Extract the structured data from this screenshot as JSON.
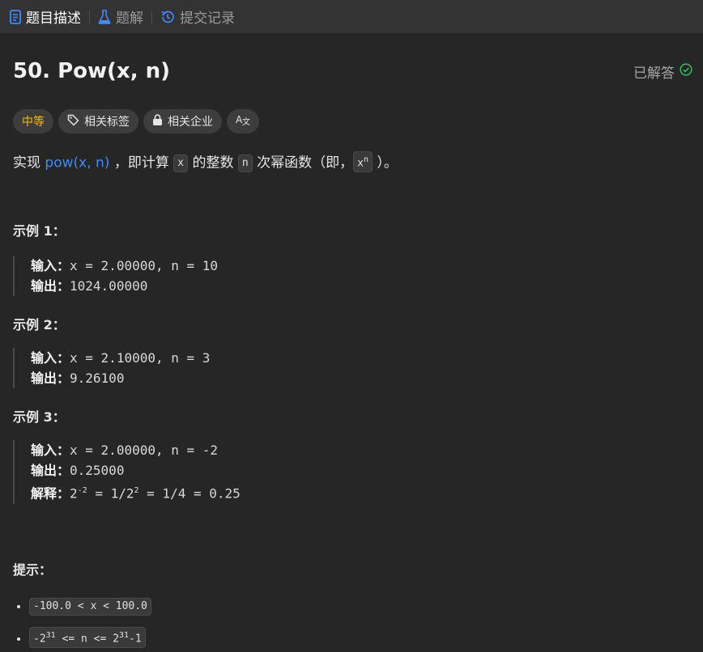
{
  "tabs": [
    {
      "label": "题目描述",
      "icon": "document-icon",
      "active": true
    },
    {
      "label": "题解",
      "icon": "flask-icon",
      "active": false
    },
    {
      "label": "提交记录",
      "icon": "history-icon",
      "active": false
    }
  ],
  "problem": {
    "title": "50. Pow(x, n)",
    "status": "已解答",
    "difficulty": "中等",
    "tags": [
      "相关标签",
      "相关企业"
    ],
    "translate_icon": "translate-icon"
  },
  "desc": {
    "p1": "实现 ",
    "link": "pow(x, n)",
    "p2": " ，即计算 ",
    "code_x": "x",
    "p3": " 的整数 ",
    "code_n": "n",
    "p4": " 次幂函数（即，",
    "code_x2": "x",
    "sup_n": "n",
    "p5": " ）。"
  },
  "examples": [
    {
      "title": "示例 1：",
      "input_label": "输入：",
      "input": "x = 2.00000, n = 10",
      "output_label": "输出：",
      "output": "1024.00000"
    },
    {
      "title": "示例 2：",
      "input_label": "输入：",
      "input": "x = 2.10000, n = 3",
      "output_label": "输出：",
      "output": "9.26100"
    },
    {
      "title": "示例 3：",
      "input_label": "输入：",
      "input": "x = 2.00000, n = -2",
      "output_label": "输出：",
      "output": "0.25000",
      "explain_label": "解释：",
      "explain_a": "2",
      "explain_a_sup": "-2",
      "explain_b": " = 1/2",
      "explain_b_sup": "2",
      "explain_c": " = 1/4 = 0.25"
    }
  ],
  "hints": {
    "title": "提示：",
    "items": [
      {
        "text": "-100.0 < x < 100.0"
      },
      {
        "a": "-2",
        "a_sup": "31",
        "b": " <= n <= 2",
        "b_sup": "31",
        "c": "-1"
      }
    ]
  },
  "colors": {
    "accent": "#3b8cff",
    "difficulty": "#ffb800",
    "solved_check": "#2cbb5d"
  }
}
